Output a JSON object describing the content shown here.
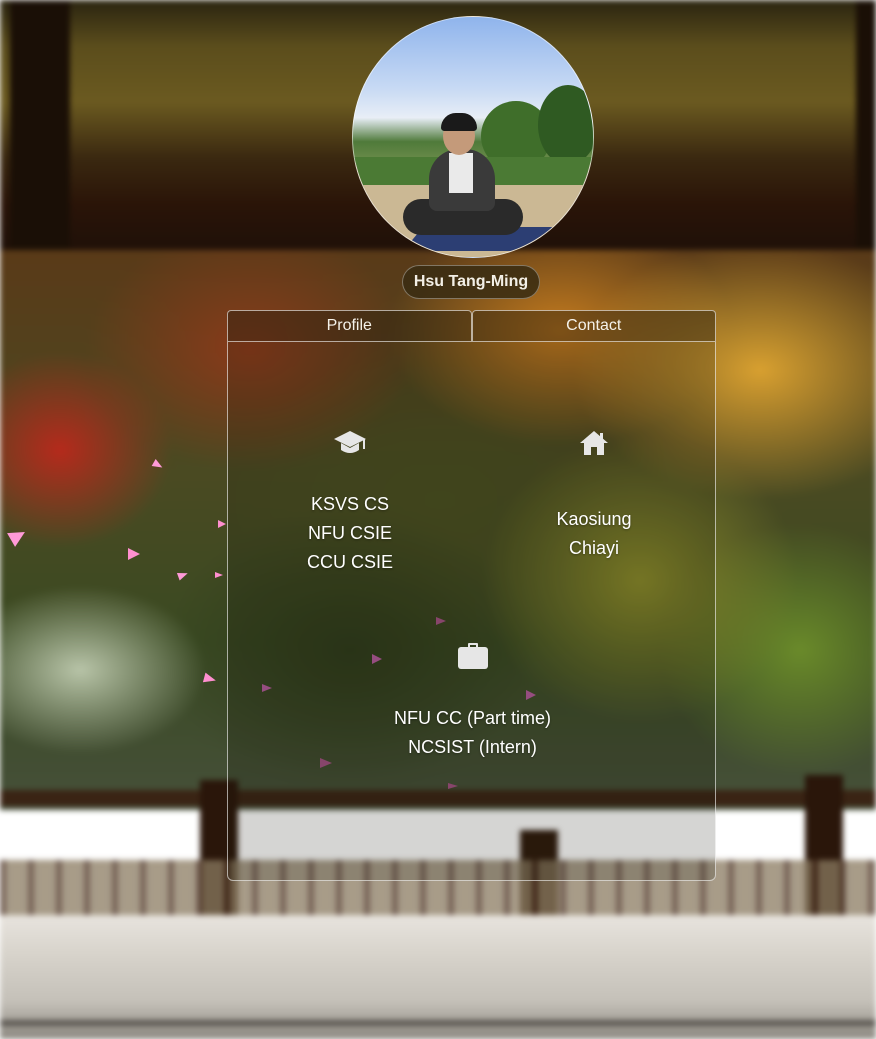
{
  "profile": {
    "name": "Hsu Tang-Ming"
  },
  "tabs": [
    {
      "label": "Profile"
    },
    {
      "label": "Contact"
    }
  ],
  "education": {
    "icon": "graduation-cap-icon",
    "items": [
      "KSVS CS",
      "NFU CSIE",
      "CCU CSIE"
    ]
  },
  "hometown": {
    "icon": "home-icon",
    "items": [
      "Kaosiung",
      "Chiayi"
    ]
  },
  "work": {
    "icon": "briefcase-icon",
    "items": [
      "NFU CC (Part time)",
      "NCSIST (Intern)"
    ]
  },
  "colors": {
    "name_badge_bg": "#3a2c12",
    "text": "#ffffff",
    "petal": "#ff8fd0"
  }
}
